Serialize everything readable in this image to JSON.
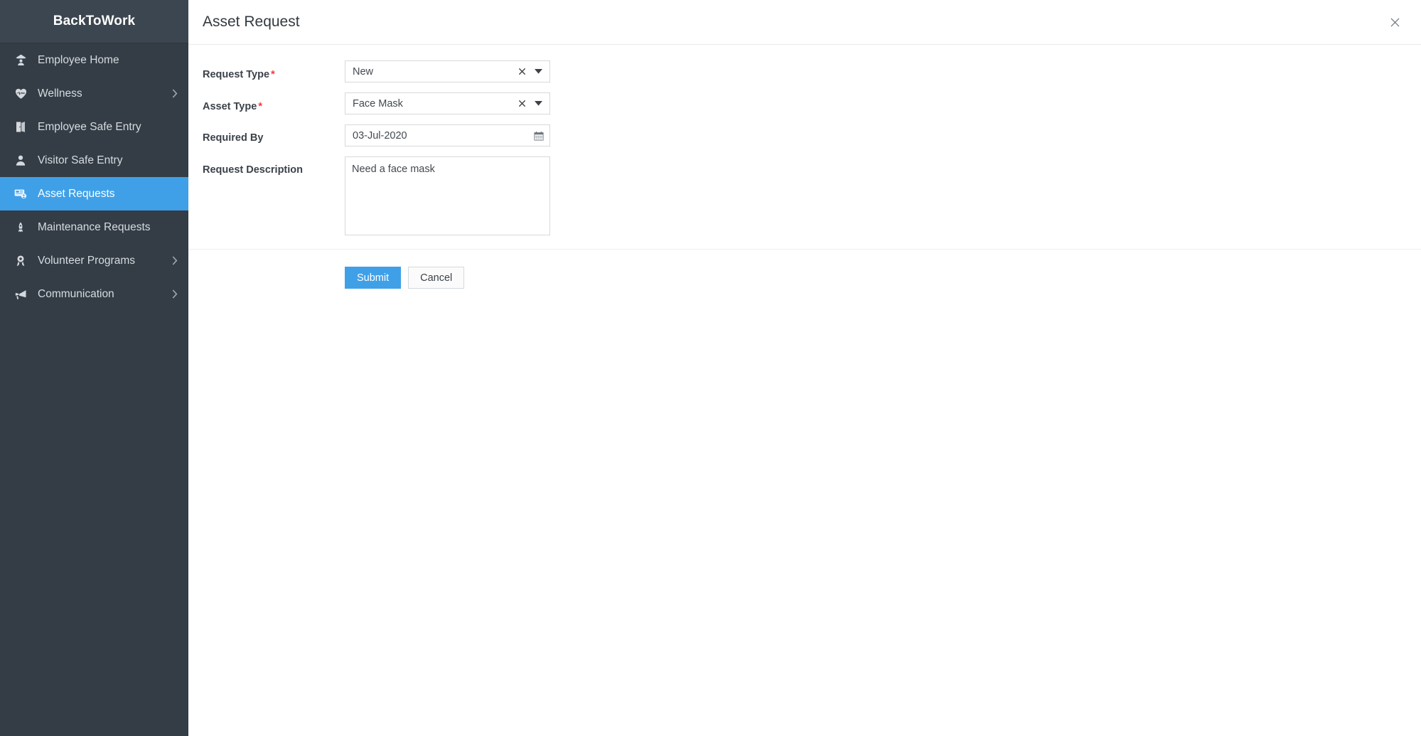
{
  "sidebar": {
    "logo": "BackToWork",
    "accent_active": "#3fa0e8",
    "bg": "#343d46",
    "items": [
      {
        "label": "Employee Home",
        "icon": "employee-home-icon",
        "expandable": false,
        "active": false
      },
      {
        "label": "Wellness",
        "icon": "heart-pulse-icon",
        "expandable": true,
        "active": false
      },
      {
        "label": "Employee Safe Entry",
        "icon": "door-icon",
        "expandable": false,
        "active": false
      },
      {
        "label": "Visitor Safe Entry",
        "icon": "person-icon",
        "expandable": false,
        "active": false
      },
      {
        "label": "Asset Requests",
        "icon": "asset-card-icon",
        "expandable": false,
        "active": true
      },
      {
        "label": "Maintenance Requests",
        "icon": "maintenance-tool-icon",
        "expandable": false,
        "active": false
      },
      {
        "label": "Volunteer Programs",
        "icon": "award-medal-icon",
        "expandable": true,
        "active": false
      },
      {
        "label": "Communication",
        "icon": "megaphone-icon",
        "expandable": true,
        "active": false
      }
    ],
    "chevron_icon": "chevron-right-icon"
  },
  "header": {
    "title": "Asset Request",
    "close_icon": "close-icon"
  },
  "form": {
    "required_marker": "*",
    "fields": {
      "request_type": {
        "label": "Request Type",
        "required": true,
        "value": "New",
        "placeholder": "Select",
        "clear_icon": "clear-x-icon",
        "caret_icon": "caret-down-icon",
        "options": [
          "New"
        ]
      },
      "asset_type": {
        "label": "Asset Type",
        "required": true,
        "value": "Face Mask",
        "placeholder": "Select",
        "clear_icon": "clear-x-icon",
        "caret_icon": "caret-down-icon",
        "options": [
          "Face Mask"
        ]
      },
      "required_by": {
        "label": "Required By",
        "required": false,
        "value": "03-Jul-2020",
        "placeholder": "dd-MMM-yyyy",
        "calendar_icon": "calendar-icon"
      },
      "request_description": {
        "label": "Request Description",
        "required": false,
        "value": "Need a face mask",
        "placeholder": ""
      }
    },
    "buttons": {
      "submit": "Submit",
      "cancel": "Cancel"
    }
  }
}
